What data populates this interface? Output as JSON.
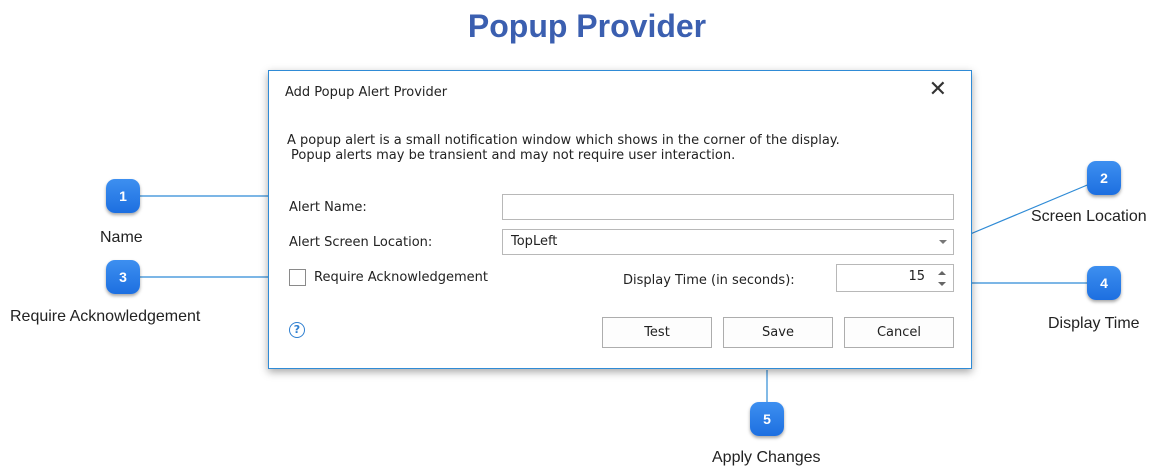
{
  "page_title": "Popup Provider",
  "dialog": {
    "title": "Add Popup Alert Provider",
    "close_glyph": "✕",
    "description_line1": "A popup alert is a small notification window which shows in the corner of the display.",
    "description_line2": "Popup alerts may be transient and may not require user interaction.",
    "alert_name_label": "Alert Name:",
    "alert_name_value": "",
    "screen_location_label": "Alert Screen Location:",
    "screen_location_value": "TopLeft",
    "require_ack_label": "Require Acknowledgement",
    "require_ack_checked": false,
    "display_time_label": "Display Time (in seconds):",
    "display_time_value": "15",
    "help_glyph": "?",
    "buttons": {
      "test": "Test",
      "save": "Save",
      "cancel": "Cancel"
    }
  },
  "callouts": [
    {
      "number": "1",
      "caption": "Name"
    },
    {
      "number": "2",
      "caption": "Screen Location"
    },
    {
      "number": "3",
      "caption": "Require Acknowledgement"
    },
    {
      "number": "4",
      "caption": "Display Time"
    },
    {
      "number": "5",
      "caption": "Apply Changes"
    }
  ],
  "colors": {
    "title": "#3b5fb0",
    "marker": "#1d6fe0",
    "connector": "#2f8bd6"
  }
}
